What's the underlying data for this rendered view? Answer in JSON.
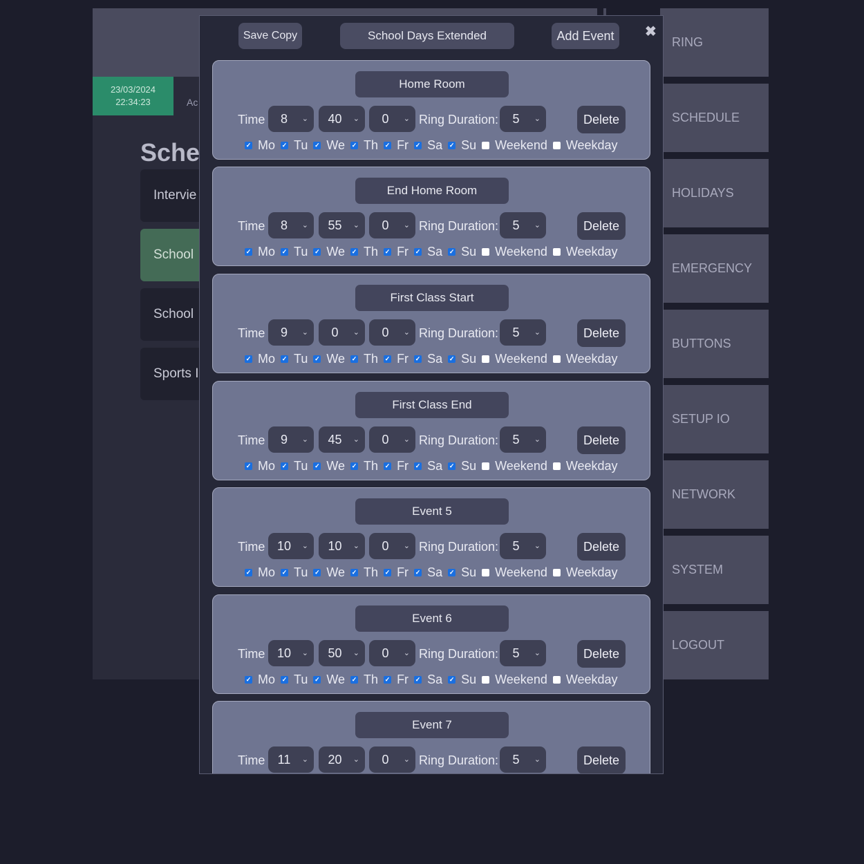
{
  "app": {
    "date": "23/03/2024",
    "time": "22:34:23",
    "admin_partial": "Ac",
    "section_title": "Sche",
    "schedules": [
      {
        "label": "Intervie",
        "active": false
      },
      {
        "label": "School",
        "active": true
      },
      {
        "label": "School",
        "active": false
      },
      {
        "label": "Sports I",
        "active": false
      }
    ]
  },
  "nav": [
    {
      "label": "RING"
    },
    {
      "label": "SCHEDULE"
    },
    {
      "label": "HOLIDAYS"
    },
    {
      "label": "EMERGENCY"
    },
    {
      "label": "BUTTONS"
    },
    {
      "label": "SETUP IO"
    },
    {
      "label": "NETWORK"
    },
    {
      "label": "SYSTEM"
    },
    {
      "label": "LOGOUT"
    }
  ],
  "modal": {
    "save_copy": "Save Copy",
    "schedule_name": "School Days Extended",
    "add_event": "Add Event",
    "close": "✖",
    "time_label": "Time",
    "ring_duration_label": "Ring Duration:",
    "delete_label": "Delete",
    "check_mark": "✓",
    "events": [
      {
        "name": "Home Room",
        "hour": "8",
        "minute": "40",
        "second": "0",
        "duration": "5"
      },
      {
        "name": "End Home Room",
        "hour": "8",
        "minute": "55",
        "second": "0",
        "duration": "5"
      },
      {
        "name": "First Class Start",
        "hour": "9",
        "minute": "0",
        "second": "0",
        "duration": "5"
      },
      {
        "name": "First Class End",
        "hour": "9",
        "minute": "45",
        "second": "0",
        "duration": "5"
      },
      {
        "name": "Event 5",
        "hour": "10",
        "minute": "10",
        "second": "0",
        "duration": "5"
      },
      {
        "name": "Event 6",
        "hour": "10",
        "minute": "50",
        "second": "0",
        "duration": "5"
      },
      {
        "name": "Event 7",
        "hour": "11",
        "minute": "20",
        "second": "0",
        "duration": "5"
      }
    ],
    "days": [
      {
        "label": "Mo",
        "checked": true
      },
      {
        "label": "Tu",
        "checked": true
      },
      {
        "label": "We",
        "checked": true
      },
      {
        "label": "Th",
        "checked": true
      },
      {
        "label": "Fr",
        "checked": true
      },
      {
        "label": "Sa",
        "checked": true
      },
      {
        "label": "Su",
        "checked": true
      },
      {
        "label": "Weekend",
        "checked": false
      },
      {
        "label": "Weekday",
        "checked": false
      }
    ]
  },
  "colors": {
    "accent_green": "#2b8c6a",
    "active_schedule": "#446b56",
    "card_bg": "#6f7591",
    "checkbox_blue": "#1a6fe0"
  }
}
